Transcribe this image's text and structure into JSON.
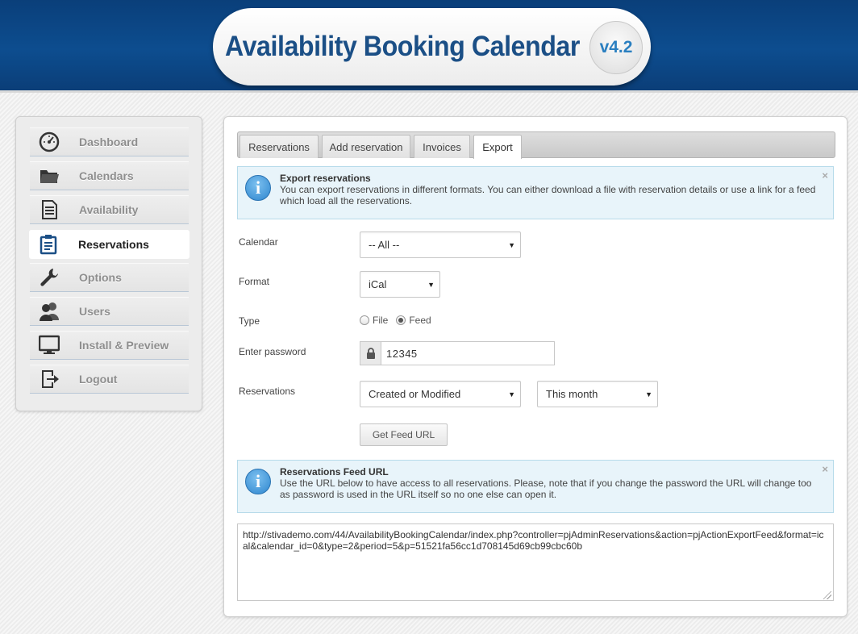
{
  "app": {
    "title": "Availability Booking Calendar",
    "version": "v4.2"
  },
  "sidebar": {
    "items": [
      {
        "label": "Dashboard",
        "icon": "speedometer-icon"
      },
      {
        "label": "Calendars",
        "icon": "folder-icon"
      },
      {
        "label": "Availability",
        "icon": "document-list-icon"
      },
      {
        "label": "Reservations",
        "icon": "clipboard-icon",
        "active": true
      },
      {
        "label": "Options",
        "icon": "wrench-icon"
      },
      {
        "label": "Users",
        "icon": "users-icon"
      },
      {
        "label": "Install & Preview",
        "icon": "monitor-icon"
      },
      {
        "label": "Logout",
        "icon": "logout-icon"
      }
    ]
  },
  "tabs": [
    {
      "label": "Reservations"
    },
    {
      "label": "Add reservation"
    },
    {
      "label": "Invoices"
    },
    {
      "label": "Export",
      "active": true
    }
  ],
  "notice_export": {
    "title": "Export reservations",
    "body": "You can export reservations in different formats. You can either download a file with reservation details or use a link for a feed which load all the reservations.",
    "close": "×"
  },
  "form": {
    "calendar": {
      "label": "Calendar",
      "value": "-- All --"
    },
    "format": {
      "label": "Format",
      "value": "iCal"
    },
    "type": {
      "label": "Type",
      "options": [
        "File",
        "Feed"
      ],
      "selected": "Feed"
    },
    "password": {
      "label": "Enter password",
      "value": "12345"
    },
    "reservations": {
      "label": "Reservations",
      "value": "Created or Modified",
      "period": "This month"
    },
    "submit_label": "Get Feed URL"
  },
  "notice_feed": {
    "title": "Reservations Feed URL",
    "body": "Use the URL below to have access to all reservations. Please, note that if you change the password the URL will change too as password is used in the URL itself so no one else can open it.",
    "close": "×"
  },
  "feed_url": "http://stivademo.com/44/AvailabilityBookingCalendar/index.php?controller=pjAdminReservations&action=pjActionExportFeed&format=ical&calendar_id=0&type=2&period=5&p=51521fa56cc1d708145d69cb99cbc60b",
  "colors": {
    "header_blue": "#0d4d8f",
    "logo_text": "#1b4f86",
    "version_text": "#2a7fc0",
    "notice_bg": "#e8f4fa"
  }
}
